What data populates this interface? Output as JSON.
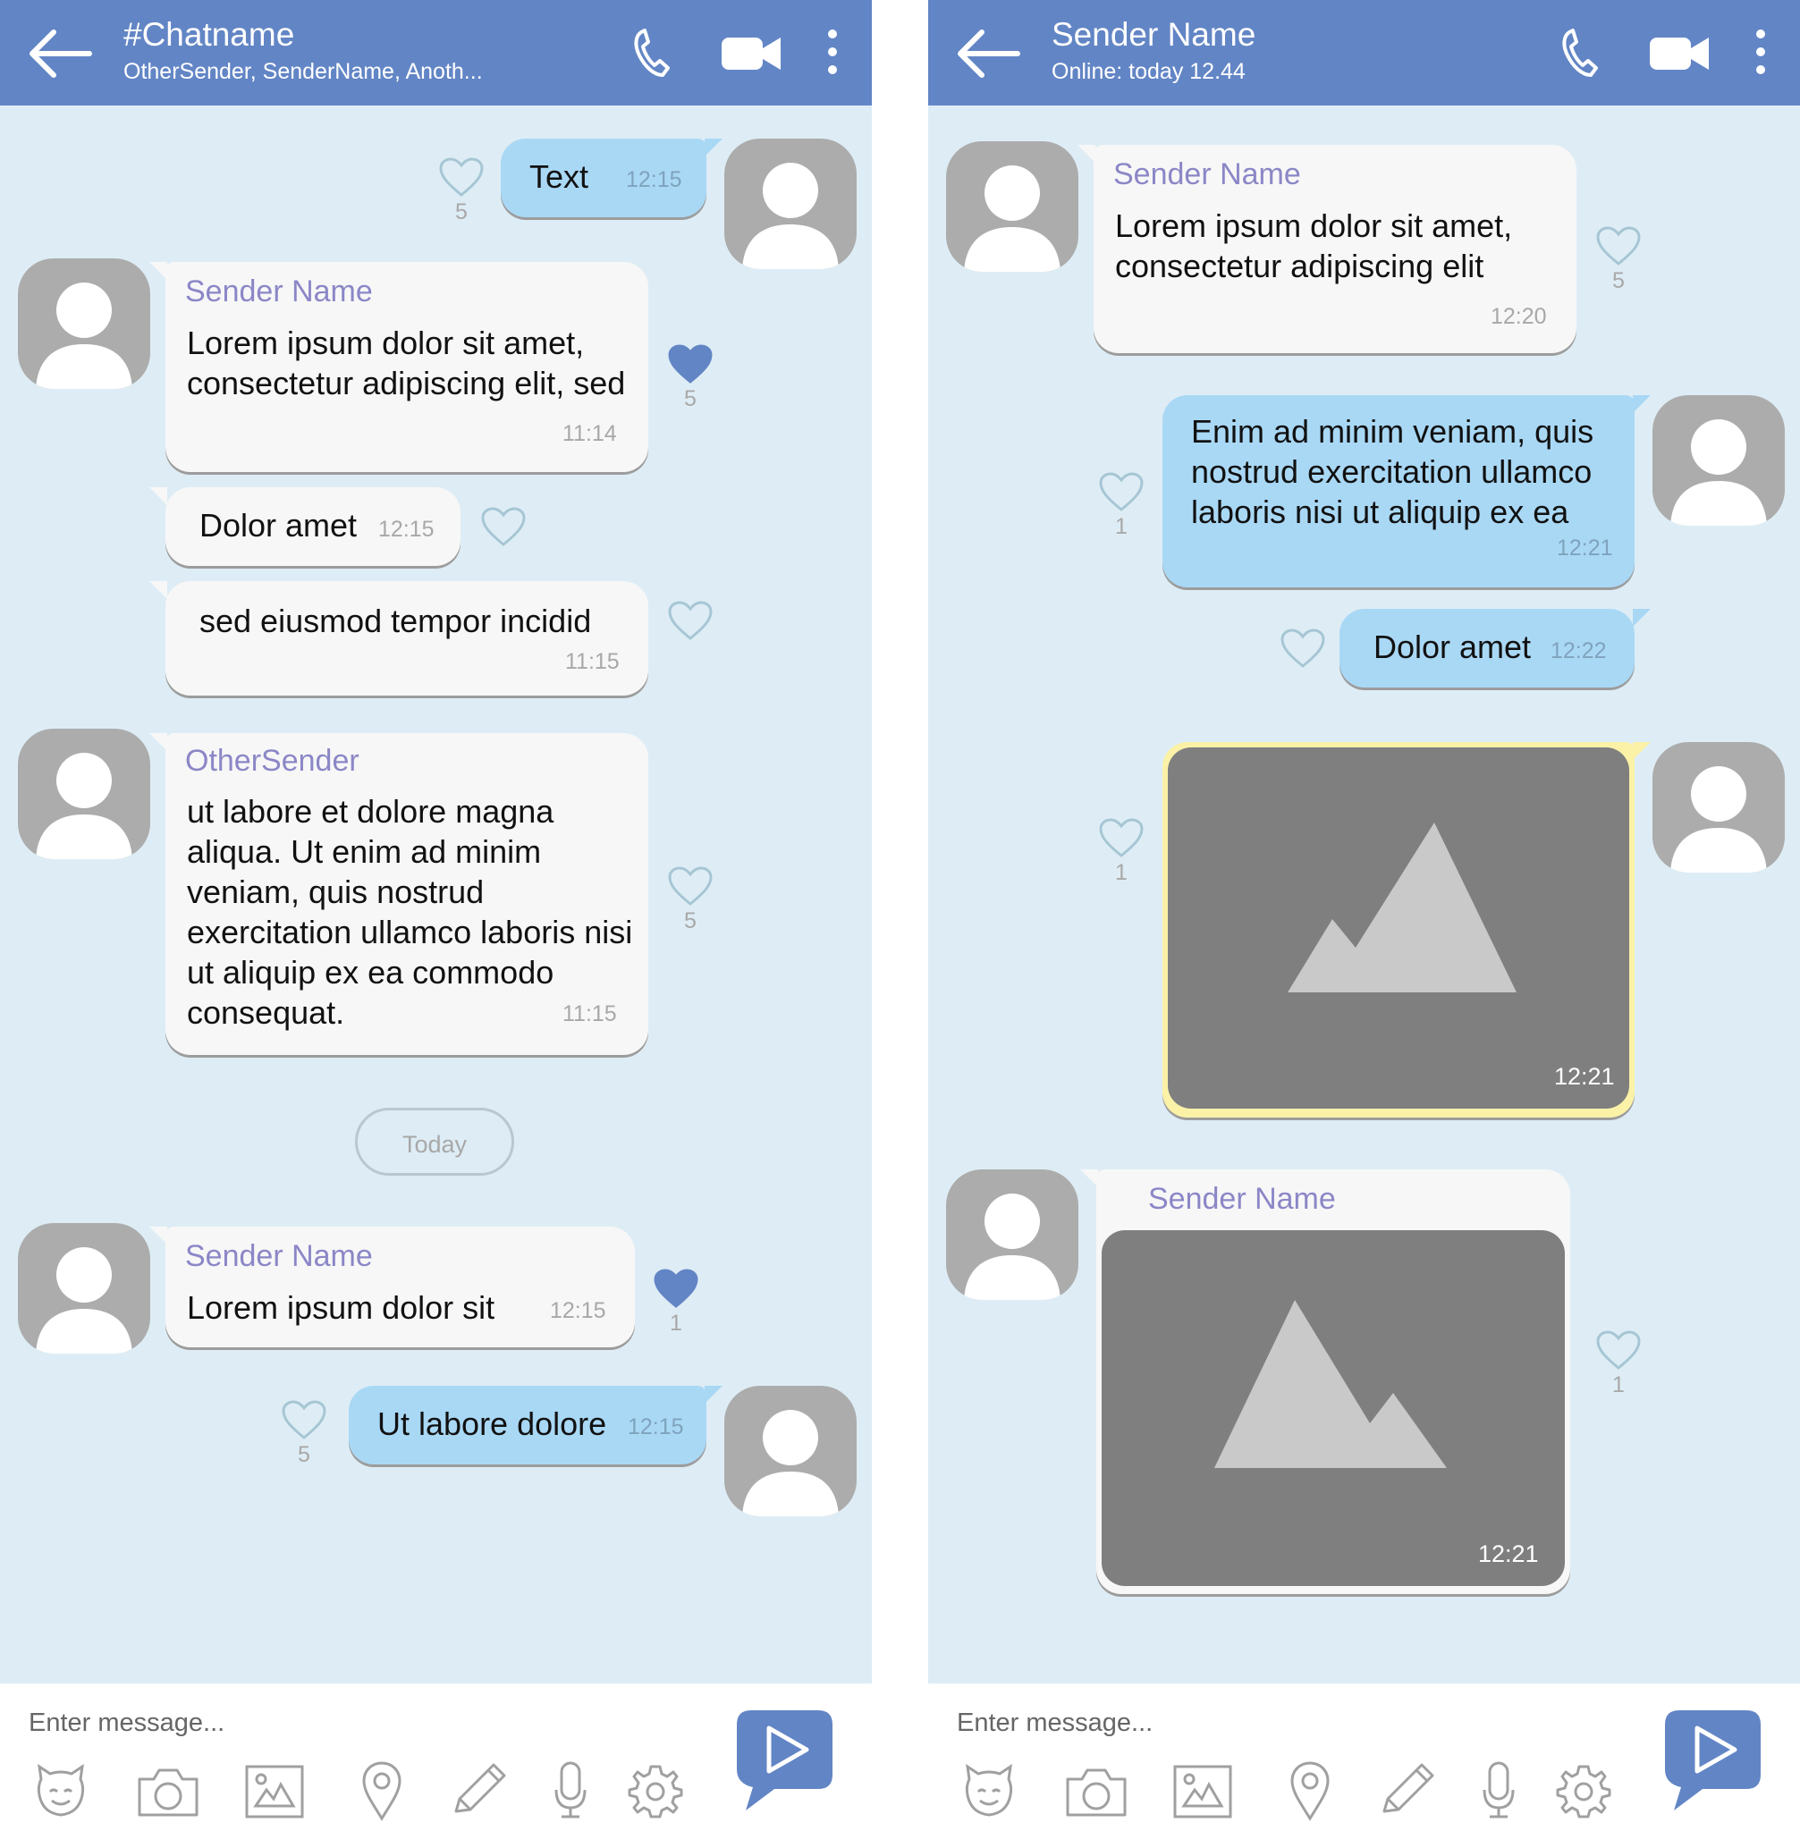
{
  "colors": {
    "header": "#6285c5",
    "chat_bg": "#deedf5",
    "incoming": "#f7f7f7",
    "outgoing": "#a9d8f5",
    "sender_name": "#8b87c7",
    "liked_heart": "#6285c5"
  },
  "left": {
    "header": {
      "title": "#Chatname",
      "subtitle": "OtherSender, SenderName, Anoth..."
    },
    "messages": [
      {
        "text": "Text",
        "time": "12:15",
        "likes": "5"
      },
      {
        "sender": "Sender Name",
        "text": "Lorem ipsum dolor sit amet, consectetur adipiscing elit, sed",
        "time": "11:14",
        "likes": "5",
        "liked": true
      },
      {
        "text": "Dolor amet",
        "time": "12:15"
      },
      {
        "text": "sed eiusmod tempor incidid",
        "time": "11:15"
      },
      {
        "sender": "OtherSender",
        "text": "ut labore et dolore magna aliqua. Ut enim ad minim veniam, quis nostrud exercitation ullamco laboris nisi ut aliquip ex ea commodo consequat.",
        "time": "11:15",
        "likes": "5"
      },
      {
        "sender": "Sender Name",
        "text": "Lorem ipsum dolor sit",
        "time": "12:15",
        "likes": "1",
        "liked": true
      },
      {
        "text": "Ut labore dolore",
        "time": "12:15",
        "likes": "5"
      }
    ],
    "date_divider": "Today",
    "composer": {
      "placeholder": "Enter message..."
    }
  },
  "right": {
    "header": {
      "title": "Sender Name",
      "subtitle": "Online: today 12.44"
    },
    "messages": [
      {
        "sender": "Sender Name",
        "text": "Lorem ipsum dolor sit amet, consectetur adipiscing elit",
        "time": "12:20",
        "likes": "5"
      },
      {
        "text": "Enim ad minim veniam, quis nostrud exercitation ullamco laboris nisi ut aliquip ex ea",
        "time": "12:21",
        "likes": "1"
      },
      {
        "text": "Dolor amet",
        "time": "12:22"
      },
      {
        "image": "image-placeholder",
        "time": "12:21",
        "likes": "1"
      },
      {
        "sender": "Sender Name",
        "image": "image-placeholder",
        "time": "12:21",
        "likes": "1"
      }
    ],
    "composer": {
      "placeholder": "Enter message..."
    }
  },
  "icons": {
    "header": [
      "back-arrow-icon",
      "phone-icon",
      "video-camera-icon",
      "more-vertical-icon"
    ],
    "toolbar": [
      "emoji-icon",
      "camera-icon",
      "gallery-icon",
      "location-pin-icon",
      "pencil-icon",
      "microphone-icon",
      "settings-gear-icon"
    ],
    "send": "send-icon",
    "like": "heart-icon"
  }
}
